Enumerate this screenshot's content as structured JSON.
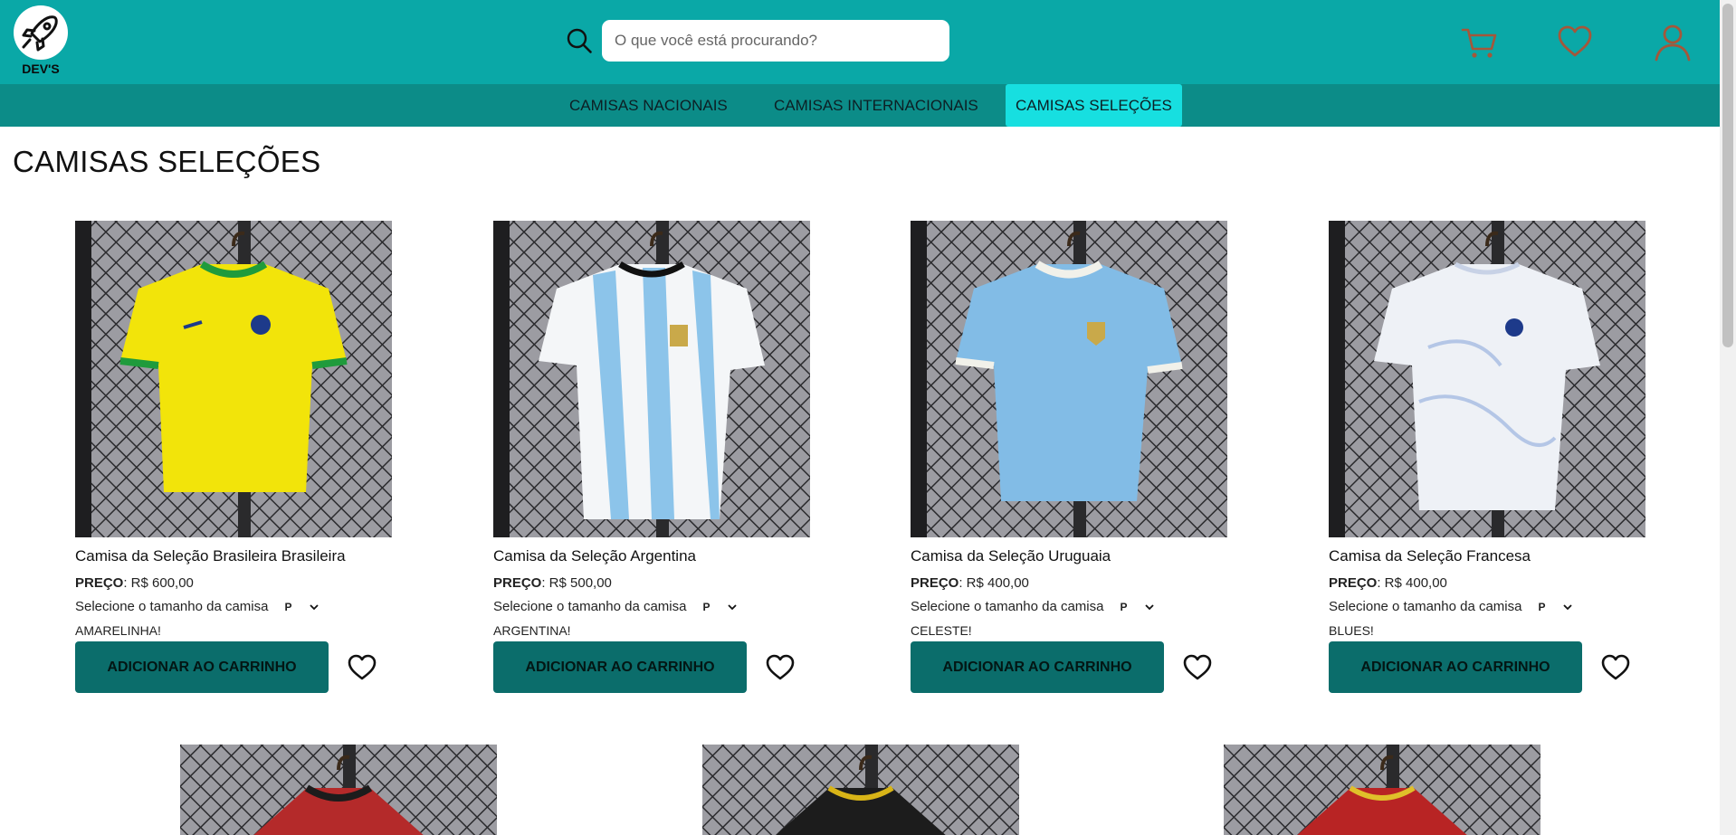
{
  "brand": {
    "name": "DEV'S"
  },
  "search": {
    "placeholder": "O que você está procurando?"
  },
  "header_icons": [
    "cart-icon",
    "heart-icon",
    "user-icon"
  ],
  "nav": {
    "items": [
      {
        "label": "CAMISAS NACIONAIS"
      },
      {
        "label": "CAMISAS INTERNACIONAIS"
      },
      {
        "label": "CAMISAS SELEÇÕES",
        "active": true
      }
    ]
  },
  "page": {
    "title": "CAMISAS SELEÇÕES"
  },
  "products": [
    {
      "name": "Camisa da Seleção Brasileira Brasileira",
      "price_label": "PREÇO",
      "price": ": R$ 600,00",
      "size_prompt": "Selecione o tamanho da camisa",
      "size": "P",
      "tagline": "AMARELINHA!",
      "button": "ADICIONAR AO CARRINHO",
      "shirt_color": "#f2e40a",
      "trim_color": "#1f9b3c"
    },
    {
      "name": "Camisa da Seleção Argentina",
      "price_label": "PREÇO",
      "price": ": R$ 500,00",
      "size_prompt": "Selecione o tamanho da camisa",
      "size": "P",
      "tagline": "ARGENTINA!",
      "button": "ADICIONAR AO CARRINHO",
      "shirt_color": "#f4f6f8",
      "trim_color": "#8cc4ea"
    },
    {
      "name": "Camisa da Seleção Uruguaia",
      "price_label": "PREÇO",
      "price": ": R$ 400,00",
      "size_prompt": "Selecione o tamanho da camisa",
      "size": "P",
      "tagline": "CELESTE!",
      "button": "ADICIONAR AO CARRINHO",
      "shirt_color": "#82bce6",
      "trim_color": "#f1f1ea"
    },
    {
      "name": "Camisa da Seleção Francesa",
      "price_label": "PREÇO",
      "price": ": R$ 400,00",
      "size_prompt": "Selecione o tamanho da camisa",
      "size": "P",
      "tagline": "BLUES!",
      "button": "ADICIONAR AO CARRINHO",
      "shirt_color": "#eef1f6",
      "trim_color": "#b4c6e6"
    }
  ],
  "products_row2": [
    {
      "shirt_color": "#b42a2a",
      "trim_color": "#1c1c1c"
    },
    {
      "shirt_color": "#1c1c1c",
      "trim_color": "#d8b417"
    },
    {
      "shirt_color": "#b82424",
      "trim_color": "#e0c02a"
    }
  ],
  "colors": {
    "header": "#0aa8a7",
    "nav": "#0c8c88",
    "nav_active": "#17dfe0",
    "button": "#0b6d6b"
  }
}
